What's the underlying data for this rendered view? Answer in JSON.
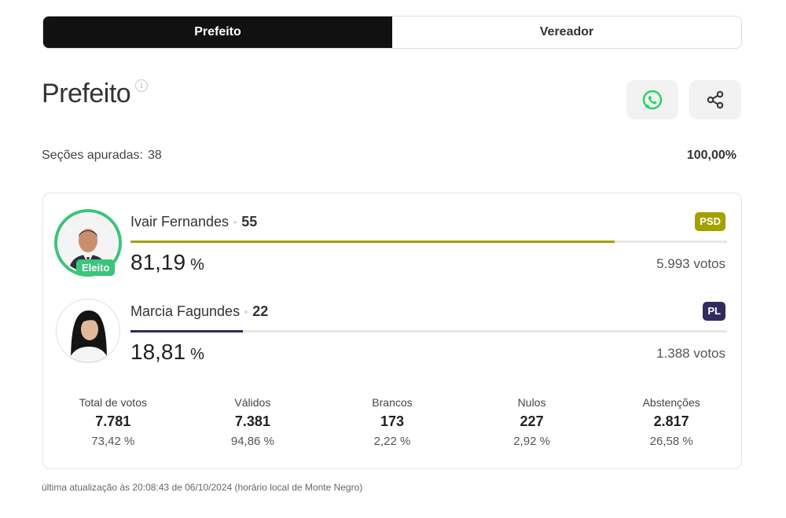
{
  "tabs": [
    {
      "label": "Prefeito",
      "active": true
    },
    {
      "label": "Vereador",
      "active": false
    }
  ],
  "page_title": "Prefeito",
  "info_icon": "i",
  "share_buttons": [
    {
      "icon": "whatsapp-icon",
      "color": "#25d366"
    },
    {
      "icon": "share-icon",
      "color": "#333333"
    }
  ],
  "secoes": {
    "label": "Seções apuradas:",
    "value": "38",
    "percent": "100,00%"
  },
  "candidates": [
    {
      "name": "Ivair Fernandes",
      "number": "55",
      "party": "PSD",
      "party_color": "#a3a100",
      "bar_color": "#a3a100",
      "share": 0.8119,
      "percent": "81,19",
      "unit": "%",
      "votes": "5.993 votos",
      "badge": "Eleito"
    },
    {
      "name": "Marcia Fagundes",
      "number": "22",
      "party": "PL",
      "party_color": "#2f2b5e",
      "bar_color": "#2f2b5e",
      "share": 0.1881,
      "percent": "18,81",
      "unit": "%",
      "votes": "1.388 votos"
    }
  ],
  "stats": [
    {
      "label": "Total de votos",
      "value": "7.781",
      "percent": "73,42 %"
    },
    {
      "label": "Válidos",
      "value": "7.381",
      "percent": "94,86 %"
    },
    {
      "label": "Brancos",
      "value": "173",
      "percent": "2,22 %"
    },
    {
      "label": "Nulos",
      "value": "227",
      "percent": "2,92 %"
    },
    {
      "label": "Abstenções",
      "value": "2.817",
      "percent": "26,58 %"
    }
  ],
  "footer": "última atualização às 20:08:43 de 06/10/2024 (horário local de Monte Negro)"
}
